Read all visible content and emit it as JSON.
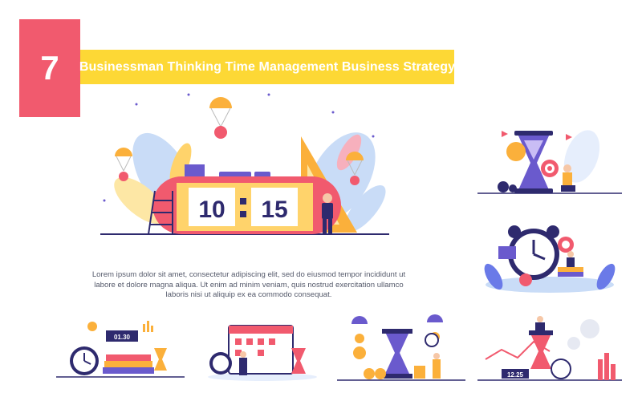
{
  "header": {
    "item_number": "7",
    "title": "Businessman Thinking Time Management Business Strategy"
  },
  "main_illustration": {
    "clock_hours": "10",
    "clock_minutes": "15"
  },
  "description": {
    "lines": [
      "Lorem ipsum dolor sit amet, consectetur adipiscing elit, sed do eiusmod tempor incididunt ut",
      "labore et dolore magna aliqua. Ut enim ad minim veniam, quis nostrud exercitation ullamco",
      "laboris nisi ut aliquip ex ea commodo consequat."
    ]
  },
  "thumbnails": {
    "calendar_clock_display": "01.30",
    "growth_chart_display": "12.25"
  },
  "colors": {
    "accent_red": "#f15a6e",
    "accent_yellow": "#fdd835",
    "navy": "#2e2a6e",
    "leaf_blue": "#c9dcf7"
  }
}
